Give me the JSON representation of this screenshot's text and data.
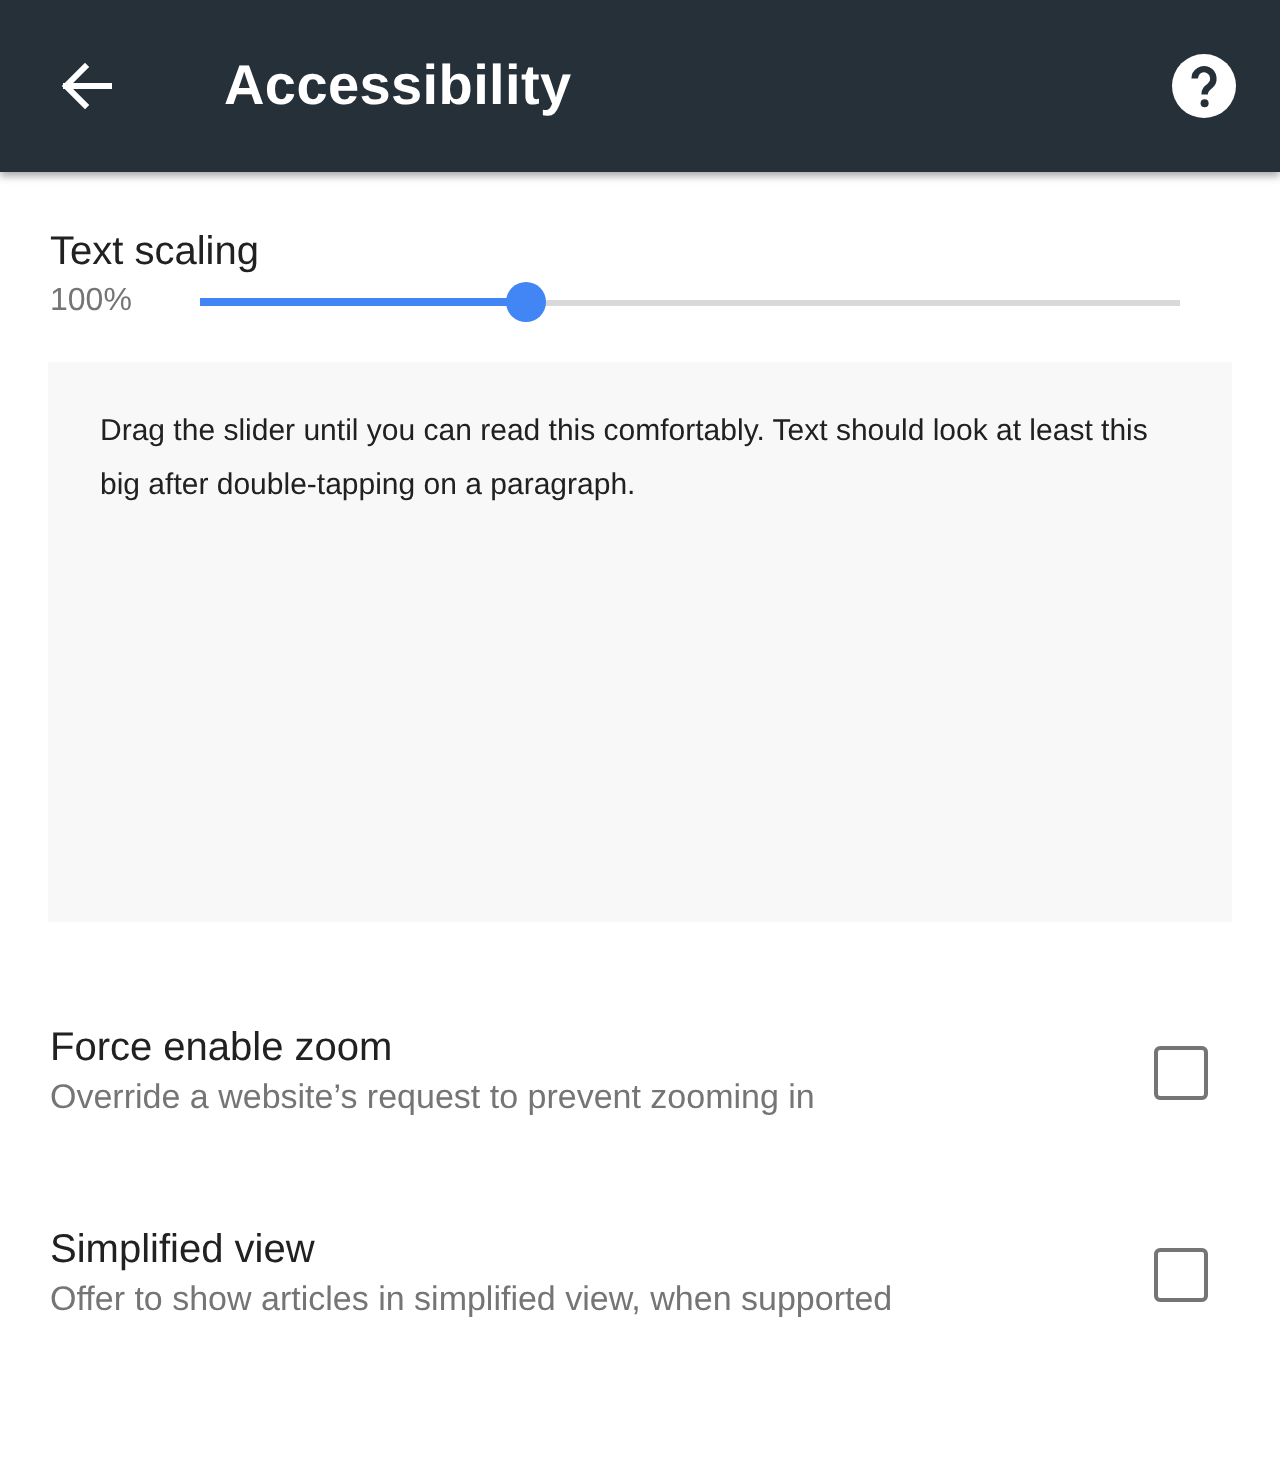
{
  "app_bar": {
    "title": "Accessibility"
  },
  "text_scaling": {
    "label": "Text scaling",
    "reading": "100%",
    "level": 0.333,
    "preview": "Drag the slider until you can read this comfortably. Text should look at least this big after double-tapping on a paragraph."
  },
  "settings": [
    {
      "title": "Force enable zoom",
      "description": "Override a website’s request to prevent zooming in",
      "checked": false
    },
    {
      "title": "Simplified view",
      "description": "Offer to show articles in simplified view, when supported",
      "checked": false
    }
  ]
}
